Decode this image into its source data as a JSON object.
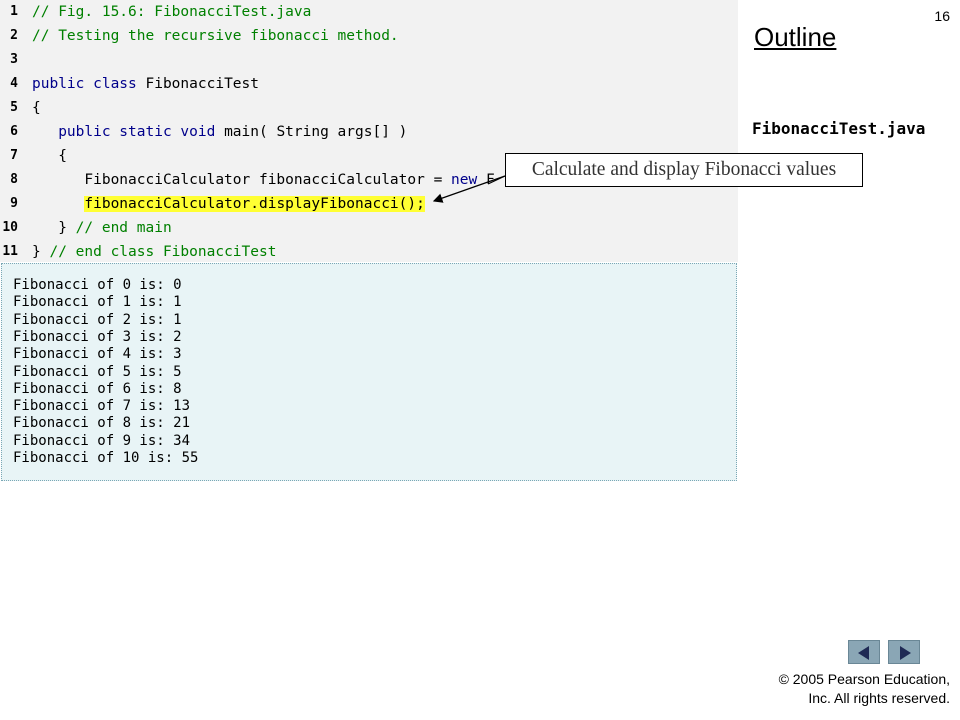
{
  "slide_number": "16",
  "outline": {
    "title": "Outline",
    "file_name": "FibonacciTest.java"
  },
  "code_lines": [
    {
      "num": "1",
      "tokens": [
        {
          "text": "// Fig. 15.6: FibonacciTest.java",
          "kind": "comment"
        }
      ]
    },
    {
      "num": "2",
      "tokens": [
        {
          "text": "// Testing the recursive fibonacci method.",
          "kind": "comment"
        }
      ]
    },
    {
      "num": "3",
      "tokens": []
    },
    {
      "num": "4",
      "tokens": [
        {
          "text": "public class",
          "kind": "keyword"
        },
        {
          "text": " FibonacciTest",
          "kind": "plain"
        }
      ]
    },
    {
      "num": "5",
      "tokens": [
        {
          "text": "{",
          "kind": "plain"
        }
      ]
    },
    {
      "num": "6",
      "tokens": [
        {
          "text": "   ",
          "kind": "plain"
        },
        {
          "text": "public static void",
          "kind": "keyword"
        },
        {
          "text": " main( String args[] )",
          "kind": "plain"
        }
      ]
    },
    {
      "num": "7",
      "tokens": [
        {
          "text": "   {",
          "kind": "plain"
        }
      ]
    },
    {
      "num": "8",
      "tokens": [
        {
          "text": "      FibonacciCalculator fibonacciCalculator = ",
          "kind": "plain"
        },
        {
          "text": "new",
          "kind": "keyword"
        },
        {
          "text": " F",
          "kind": "plain"
        }
      ]
    },
    {
      "num": "9",
      "tokens": [
        {
          "text": "      ",
          "kind": "plain"
        },
        {
          "text": "fibonacciCalculator.displayFibonacci();",
          "kind": "highlight"
        }
      ]
    },
    {
      "num": "10",
      "tokens": [
        {
          "text": "   } ",
          "kind": "plain"
        },
        {
          "text": "// end main",
          "kind": "comment"
        }
      ]
    },
    {
      "num": "11",
      "tokens": [
        {
          "text": "} ",
          "kind": "plain"
        },
        {
          "text": "// end class FibonacciTest",
          "kind": "comment"
        }
      ]
    }
  ],
  "output_lines": [
    "Fibonacci of 0 is: 0",
    "Fibonacci of 1 is: 1",
    "Fibonacci of 2 is: 1",
    "Fibonacci of 3 is: 2",
    "Fibonacci of 4 is: 3",
    "Fibonacci of 5 is: 5",
    "Fibonacci of 6 is: 8",
    "Fibonacci of 7 is: 13",
    "Fibonacci of 8 is: 21",
    "Fibonacci of 9 is: 34",
    "Fibonacci of 10 is: 55"
  ],
  "callout": {
    "text": "Calculate and display Fibonacci values"
  },
  "nav": {
    "prev_icon": "triangle-left-icon",
    "next_icon": "triangle-right-icon"
  },
  "copyright": {
    "line1": "© 2005 Pearson Education,",
    "line2": "Inc.  All rights reserved."
  },
  "colors": {
    "comment": "#008000",
    "keyword": "#00008b",
    "highlight": "#ffff33",
    "code_background": "#f2f2f2",
    "output_background": "#e8f4f6",
    "nav_button": "#8aa6b5"
  }
}
